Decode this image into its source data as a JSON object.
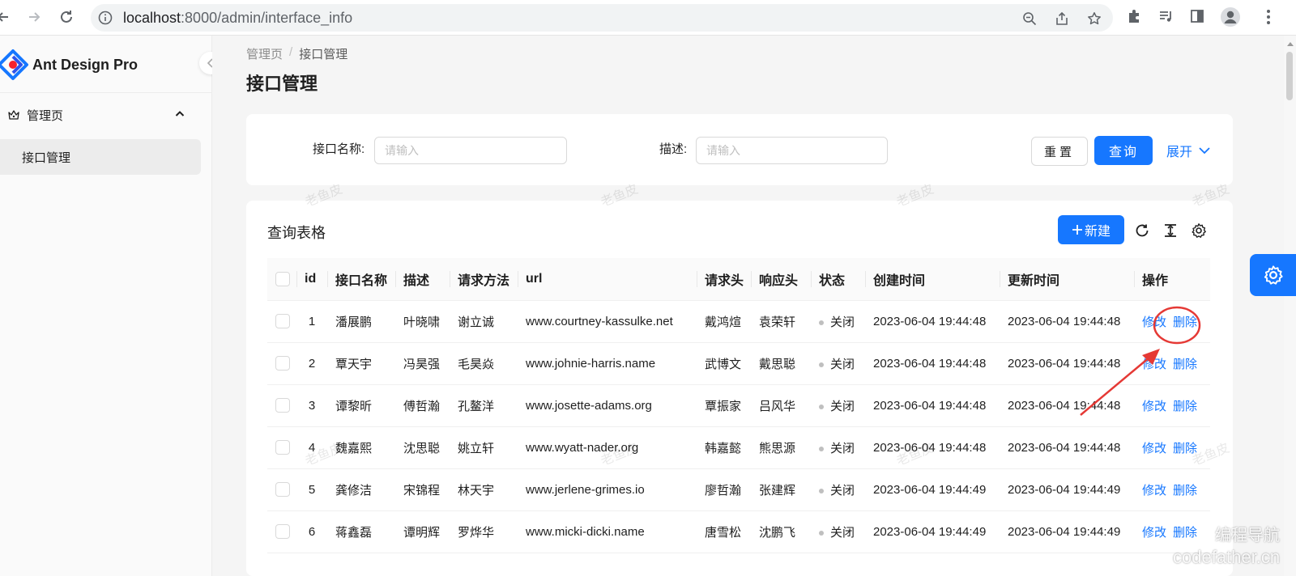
{
  "browser": {
    "url_host": "localhost",
    "url_path": ":8000/admin/interface_info"
  },
  "sidebar": {
    "brand": "Ant Design Pro",
    "menu_group": "管理页",
    "menu_item": "接口管理"
  },
  "breadcrumb": {
    "root": "管理页",
    "separator": "/",
    "current": "接口管理"
  },
  "page_title": "接口管理",
  "search": {
    "name_label": "接口名称:",
    "name_placeholder": "请输入",
    "desc_label": "描述:",
    "desc_placeholder": "请输入",
    "reset": "重置",
    "query": "查询",
    "expand": "展开"
  },
  "table": {
    "title": "查询表格",
    "new_button": "新建",
    "columns": [
      "id",
      "接口名称",
      "描述",
      "请求方法",
      "url",
      "请求头",
      "响应头",
      "状态",
      "创建时间",
      "更新时间",
      "操作"
    ],
    "rows": [
      {
        "id": "1",
        "name": "潘展鹏",
        "desc": "叶晓啸",
        "method": "谢立诚",
        "url": "www.courtney-kassulke.net",
        "req_header": "戴鸿煊",
        "resp_header": "袁荣轩",
        "status": "关闭",
        "created": "2023-06-04 19:44:48",
        "updated": "2023-06-04 19:44:48"
      },
      {
        "id": "2",
        "name": "覃天宇",
        "desc": "冯昊强",
        "method": "毛昊焱",
        "url": "www.johnie-harris.name",
        "req_header": "武博文",
        "resp_header": "戴思聪",
        "status": "关闭",
        "created": "2023-06-04 19:44:48",
        "updated": "2023-06-04 19:44:48"
      },
      {
        "id": "3",
        "name": "谭黎昕",
        "desc": "傅哲瀚",
        "method": "孔鳌洋",
        "url": "www.josette-adams.org",
        "req_header": "覃振家",
        "resp_header": "吕风华",
        "status": "关闭",
        "created": "2023-06-04 19:44:48",
        "updated": "2023-06-04 19:44:48"
      },
      {
        "id": "4",
        "name": "魏嘉熙",
        "desc": "沈思聪",
        "method": "姚立轩",
        "url": "www.wyatt-nader.org",
        "req_header": "韩嘉懿",
        "resp_header": "熊思源",
        "status": "关闭",
        "created": "2023-06-04 19:44:48",
        "updated": "2023-06-04 19:44:48"
      },
      {
        "id": "5",
        "name": "龚修洁",
        "desc": "宋锦程",
        "method": "林天宇",
        "url": "www.jerlene-grimes.io",
        "req_header": "廖哲瀚",
        "resp_header": "张建辉",
        "status": "关闭",
        "created": "2023-06-04 19:44:49",
        "updated": "2023-06-04 19:44:49"
      },
      {
        "id": "6",
        "name": "蒋鑫磊",
        "desc": "谭明辉",
        "method": "罗烨华",
        "url": "www.micki-dicki.name",
        "req_header": "唐雪松",
        "resp_header": "沈鹏飞",
        "status": "关闭",
        "created": "2023-06-04 19:44:49",
        "updated": "2023-06-04 19:44:49"
      }
    ],
    "actions": {
      "edit": "修改",
      "delete": "删除"
    }
  },
  "watermark_text": "老鱼皮",
  "site_watermark": {
    "line1": "编程导航",
    "line2": "codefather.cn"
  },
  "colors": {
    "primary": "#1677ff",
    "annotation": "#e53935"
  }
}
